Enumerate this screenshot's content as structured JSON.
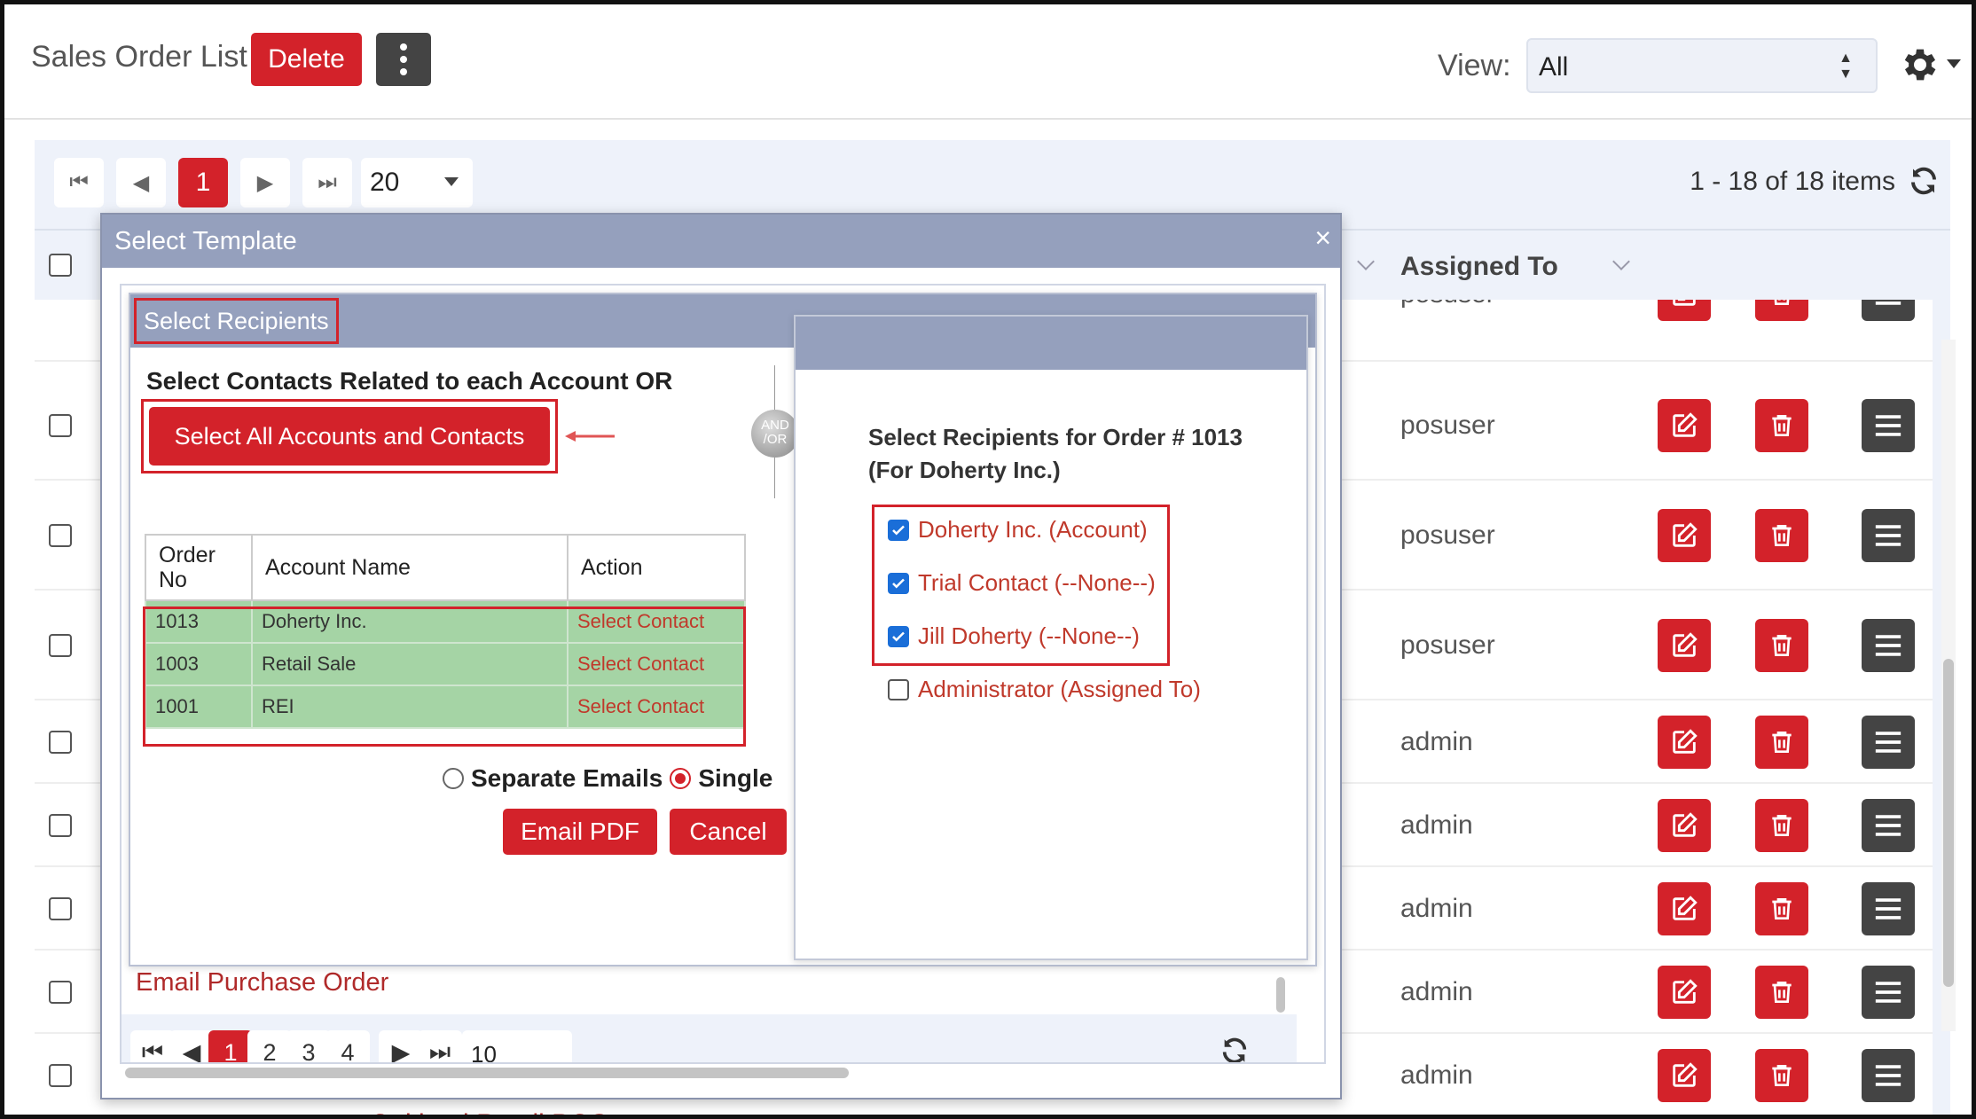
{
  "header": {
    "title": "Sales Order List",
    "delete_label": "Delete",
    "view_label": "View:",
    "view_value": "All"
  },
  "pager": {
    "current_page": "1",
    "page_size": "20",
    "items_text": "1 - 18 of 18 items"
  },
  "columns": {
    "assigned_to": "Assigned To"
  },
  "rows": [
    {
      "user": "posuser"
    },
    {
      "user": "posuser"
    },
    {
      "user": "posuser"
    },
    {
      "user": "posuser"
    },
    {
      "user": "admin"
    },
    {
      "user": "admin"
    },
    {
      "user": "admin"
    },
    {
      "user": "admin"
    },
    {
      "user": "admin"
    }
  ],
  "partial_row_text": "Oakland Retail POS",
  "template_modal": {
    "title": "Select Template",
    "close": "×",
    "email_purchase_order": "Email Purchase Order",
    "pager": {
      "pages": [
        "1",
        "2",
        "3",
        "4"
      ],
      "page_size": "10"
    }
  },
  "recipients_dialog": {
    "title": "Select Recipients",
    "related_text": "Select Contacts Related to each Account OR",
    "select_all_label": "Select All Accounts and Contacts",
    "and_or": "AND\n/OR",
    "table": {
      "headers": [
        "Order\nNo",
        "Account Name",
        "Action"
      ],
      "rows": [
        {
          "order_no": "1013",
          "account": "Doherty Inc.",
          "action": "Select Contact"
        },
        {
          "order_no": "1003",
          "account": "Retail Sale",
          "action": "Select Contact"
        },
        {
          "order_no": "1001",
          "account": "REI",
          "action": "Select Contact"
        }
      ]
    },
    "separate_label": "Separate Emails",
    "single_label": "Single",
    "email_pdf_label": "Email PDF",
    "cancel_label": "Cancel"
  },
  "order_panel": {
    "heading_line1": "Select Recipients for Order # 1013",
    "heading_line2": "(For Doherty Inc.)",
    "recipients": [
      {
        "label": "Doherty Inc. (Account)",
        "checked": true
      },
      {
        "label": "Trial Contact (--None--)",
        "checked": true
      },
      {
        "label": "Jill Doherty (--None--)",
        "checked": true
      },
      {
        "label": "Administrator (Assigned To)",
        "checked": false
      }
    ]
  },
  "colors": {
    "accent_red": "#d3222a",
    "dialog_title_bar": "#95a0bd",
    "row_highlight_green": "#a5d4a5",
    "link_red": "#c0392b"
  }
}
